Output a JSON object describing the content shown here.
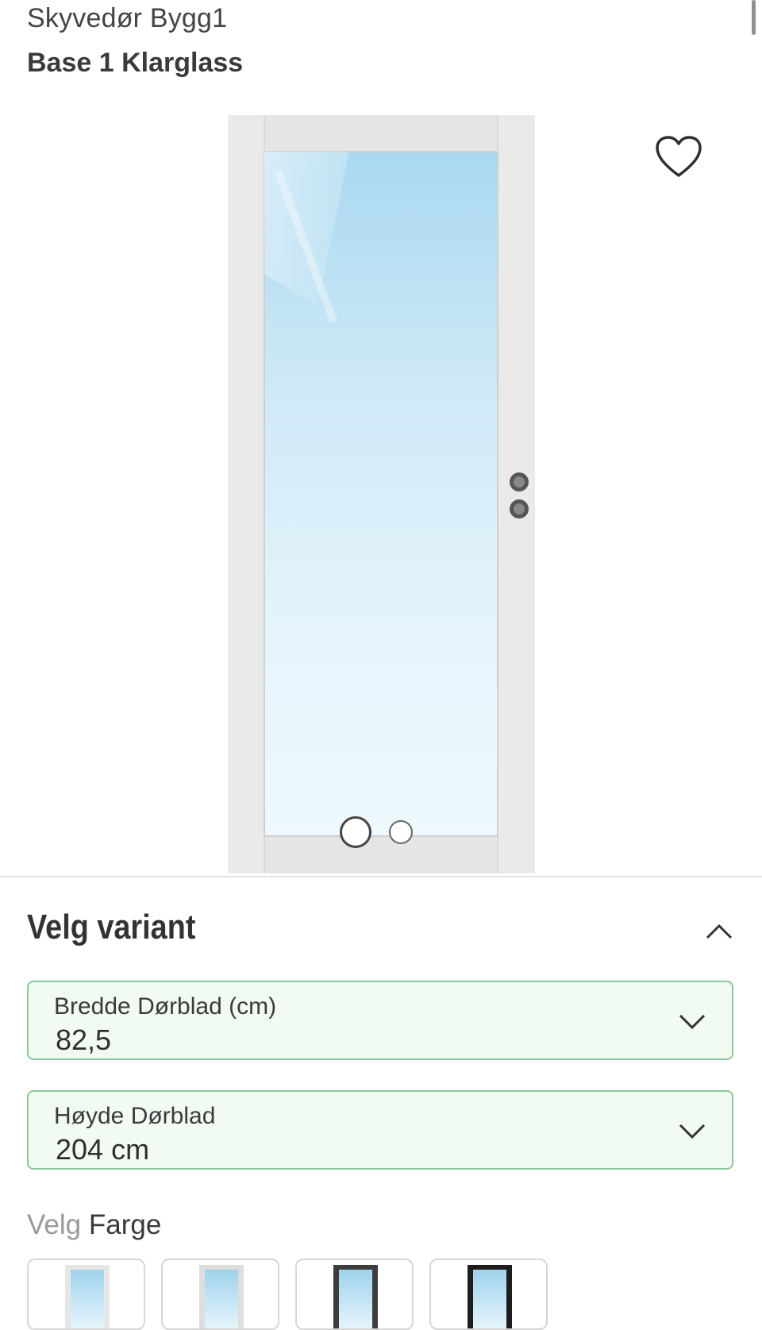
{
  "product": {
    "brand": "Skyvedør Bygg1",
    "title": "Base 1 Klarglass"
  },
  "gallery": {
    "favorite_icon": "heart-outline-icon",
    "slide_count": 2,
    "active_slide": 1
  },
  "variant": {
    "heading": "Velg variant",
    "collapse_icon": "chevron-up-icon",
    "width_select": {
      "label": "Bredde Dørblad (cm)",
      "value": "82,5"
    },
    "height_select": {
      "label": "Høyde Dørblad",
      "value": "204 cm"
    },
    "color": {
      "prefix": "Velg",
      "label": "Farge",
      "swatches": [
        {
          "name": "white-light",
          "frame": "#e6e6e6"
        },
        {
          "name": "white",
          "frame": "#dedede"
        },
        {
          "name": "dark-grey",
          "frame": "#3d3d3d"
        },
        {
          "name": "black",
          "frame": "#1d1d1d"
        }
      ]
    }
  },
  "colors": {
    "accent_border": "#8cc89a",
    "accent_fill": "#f1fbf2"
  }
}
